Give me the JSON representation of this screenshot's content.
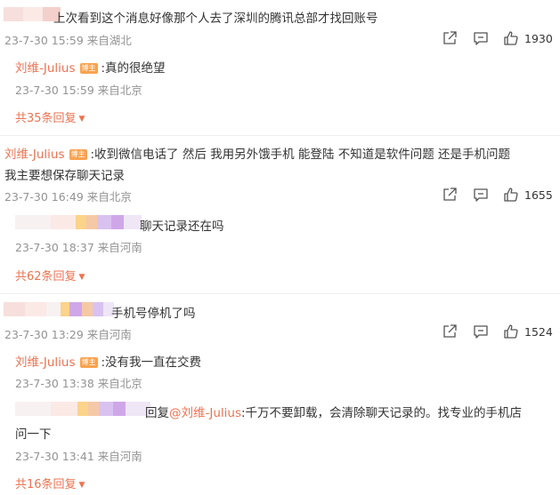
{
  "comments": [
    {
      "text": "上次看到这个消息好像那个人去了深圳的腾讯总部才找回账号",
      "time": "23-7-30 15:59",
      "location": "来自湖北",
      "likes": "1930",
      "replies": [
        {
          "author": "刘维-Julius",
          "badge": "博主",
          "text": ":真的很绝望",
          "time": "23-7-30 15:59",
          "location": "来自北京"
        }
      ],
      "more_label": "共35条回复"
    },
    {
      "author": "刘维-Julius",
      "badge": "博主",
      "text_line1": ":收到微信电话了 然后 我用另外饿手机 能登陆 不知道是软件问题 还是手机问题",
      "text_line2": "我主要想保存聊天记录",
      "time": "23-7-30 16:49",
      "location": "来自北京",
      "likes": "1655",
      "replies": [
        {
          "text": "聊天记录还在吗",
          "time": "23-7-30 18:37",
          "location": "来自河南"
        }
      ],
      "more_label": "共62条回复"
    },
    {
      "text": "手机号停机了吗",
      "time": "23-7-30 13:29",
      "location": "来自河南",
      "likes": "1524",
      "replies": [
        {
          "author": "刘维-Julius",
          "badge": "博主",
          "text": ":没有我一直在交费",
          "time": "23-7-30 13:38",
          "location": "来自北京"
        },
        {
          "reply_prefix": "回复",
          "mention": "@刘维-Julius",
          "text_line1": ":千万不要卸载，会清除聊天记录的。找专业的手机店",
          "text_line2": "问一下",
          "time": "23-7-30 13:41",
          "location": "来自河南"
        }
      ],
      "more_label": "共16条回复"
    }
  ],
  "icons": [
    "share-icon",
    "comment-icon",
    "like-icon",
    "chevron-down-icon"
  ],
  "colors": {
    "accent": "#eb7350",
    "badge": "#f7a350",
    "meta": "#939393",
    "text": "#333333"
  }
}
